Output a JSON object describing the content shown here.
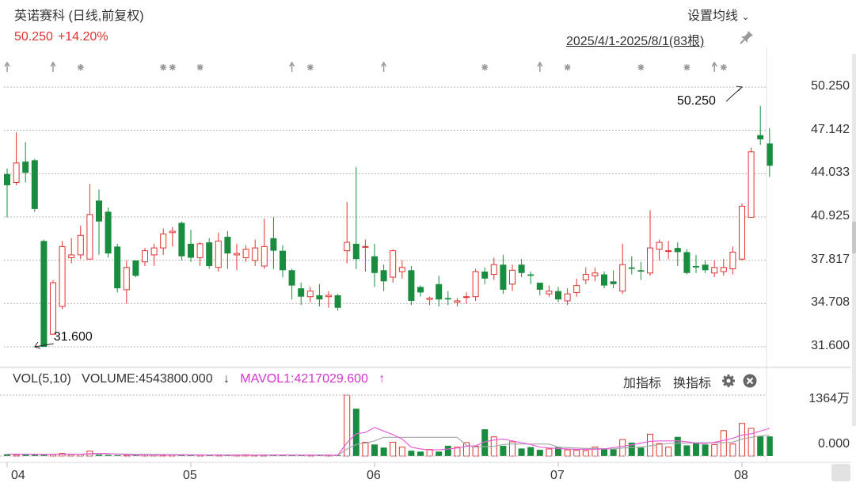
{
  "header": {
    "title": "英诺赛科 (日线,前复权)",
    "price": "50.250",
    "change_pct": "+14.20%",
    "ma_setting_label": "设置均线",
    "date_range": "2025/4/1-2025/8/1(83根)"
  },
  "volume_legend": {
    "vol_label": "VOL(5,10)",
    "volume_label": "VOLUME:4543800.000",
    "volume_arrow": "↓",
    "mavol_label": "MAVOL1:4217029.600",
    "mavol_arrow": "↑"
  },
  "toolbar": {
    "add_indicator": "加指标",
    "change_indicator": "换指标"
  },
  "colors": {
    "up": "#e0332f",
    "down": "#1a8c3f",
    "mavol1": "#e85fd8",
    "mavol2": "#a8a8a8",
    "grid": "#b5b5b5"
  },
  "chart_data": {
    "type": "candlestick",
    "y_axis_ticks": [
      "50.250",
      "47.142",
      "44.033",
      "40.925",
      "37.817",
      "34.708",
      "31.600"
    ],
    "ylim": [
      31.6,
      50.25
    ],
    "volume_axis_ticks": [
      "1364万",
      "0.000"
    ],
    "x_tick_labels": [
      "04",
      "05",
      "06",
      "07",
      "08"
    ],
    "x_tick_index": [
      0,
      20,
      40,
      60,
      80
    ],
    "annotations": [
      {
        "label": "50.250",
        "index": 80,
        "value": 50.25
      },
      {
        "label": "31.600",
        "index": 3,
        "value": 31.6
      }
    ],
    "ohlc": [
      [
        44.0,
        43.2,
        44.4,
        40.9
      ],
      [
        43.4,
        44.8,
        47.0,
        43.2
      ],
      [
        44.9,
        44.1,
        46.3,
        43.4
      ],
      [
        45.0,
        41.5,
        45.1,
        41.3
      ],
      [
        39.2,
        31.6,
        39.3,
        31.6
      ],
      [
        32.5,
        36.2,
        36.4,
        32.5
      ],
      [
        34.5,
        38.8,
        39.2,
        34.3
      ],
      [
        38.0,
        38.2,
        39.4,
        37.6
      ],
      [
        38.2,
        39.6,
        40.3,
        37.9
      ],
      [
        37.9,
        41.1,
        43.3,
        37.9
      ],
      [
        42.1,
        40.6,
        42.9,
        38.2
      ],
      [
        41.3,
        38.3,
        41.6,
        38.0
      ],
      [
        38.8,
        35.8,
        39.0,
        35.5
      ],
      [
        35.7,
        37.3,
        37.8,
        34.7
      ],
      [
        37.8,
        36.7,
        37.8,
        36.6
      ],
      [
        37.7,
        38.5,
        38.7,
        37.4
      ],
      [
        38.2,
        38.7,
        39.0,
        37.4
      ],
      [
        38.7,
        39.7,
        40.1,
        38.2
      ],
      [
        39.8,
        39.9,
        40.2,
        38.8
      ],
      [
        40.5,
        38.1,
        40.6,
        37.8
      ],
      [
        39.0,
        38.0,
        40.0,
        37.7
      ],
      [
        38.0,
        39.0,
        39.1,
        37.4
      ],
      [
        39.1,
        37.4,
        39.4,
        37.2
      ],
      [
        37.3,
        39.2,
        39.8,
        37.0
      ],
      [
        39.5,
        38.3,
        39.9,
        37.2
      ],
      [
        38.2,
        38.3,
        39.0,
        37.1
      ],
      [
        38.0,
        38.6,
        38.9,
        37.7
      ],
      [
        37.8,
        38.7,
        39.3,
        37.4
      ],
      [
        37.4,
        38.8,
        40.8,
        37.2
      ],
      [
        39.4,
        38.5,
        40.9,
        37.2
      ],
      [
        38.5,
        37.1,
        38.9,
        36.6
      ],
      [
        37.1,
        36.0,
        37.2,
        35.0
      ],
      [
        35.8,
        35.2,
        36.2,
        34.6
      ],
      [
        35.2,
        35.6,
        35.9,
        34.8
      ],
      [
        35.3,
        35.0,
        36.1,
        34.5
      ],
      [
        35.2,
        35.3,
        35.6,
        34.4
      ],
      [
        35.3,
        34.4,
        35.4,
        34.2
      ],
      [
        38.5,
        39.1,
        42.0,
        37.6
      ],
      [
        39.0,
        37.9,
        44.5,
        37.2
      ],
      [
        38.8,
        38.8,
        39.3,
        37.0
      ],
      [
        38.1,
        36.9,
        39.0,
        35.9
      ],
      [
        37.1,
        36.3,
        37.5,
        35.6
      ],
      [
        36.6,
        38.5,
        38.6,
        36.2
      ],
      [
        37.0,
        37.3,
        37.8,
        36.5
      ],
      [
        37.1,
        34.9,
        37.4,
        34.6
      ],
      [
        35.9,
        35.5,
        36.0,
        35.2
      ],
      [
        35.0,
        35.1,
        35.2,
        34.6
      ],
      [
        36.1,
        35.0,
        36.7,
        34.5
      ],
      [
        35.1,
        35.0,
        35.6,
        34.6
      ],
      [
        34.8,
        34.9,
        35.1,
        34.5
      ],
      [
        35.2,
        35.2,
        35.5,
        34.7
      ],
      [
        35.2,
        37.0,
        37.2,
        34.9
      ],
      [
        37.0,
        36.5,
        37.3,
        36.1
      ],
      [
        36.8,
        37.5,
        38.0,
        36.4
      ],
      [
        37.5,
        35.7,
        38.2,
        35.4
      ],
      [
        36.1,
        37.1,
        37.5,
        35.6
      ],
      [
        37.5,
        36.9,
        37.9,
        36.6
      ],
      [
        36.8,
        36.7,
        37.0,
        36.1
      ],
      [
        36.2,
        35.7,
        36.2,
        35.3
      ],
      [
        35.4,
        35.6,
        36.0,
        35.2
      ],
      [
        35.6,
        35.0,
        35.9,
        34.8
      ],
      [
        34.9,
        35.4,
        35.8,
        34.6
      ],
      [
        35.5,
        36.0,
        36.5,
        35.2
      ],
      [
        36.4,
        36.8,
        37.3,
        36.1
      ],
      [
        36.7,
        36.9,
        37.3,
        36.3
      ],
      [
        36.8,
        36.0,
        37.0,
        35.8
      ],
      [
        36.3,
        36.1,
        37.1,
        35.8
      ],
      [
        35.6,
        37.5,
        39.0,
        35.4
      ],
      [
        37.3,
        37.2,
        38.1,
        36.8
      ],
      [
        37.1,
        37.0,
        37.7,
        36.4
      ],
      [
        36.9,
        38.7,
        41.4,
        36.7
      ],
      [
        38.6,
        39.1,
        39.3,
        37.8
      ],
      [
        38.5,
        38.5,
        39.2,
        37.9
      ],
      [
        38.7,
        38.4,
        39.1,
        37.4
      ],
      [
        38.4,
        36.9,
        38.6,
        36.8
      ],
      [
        37.4,
        37.3,
        38.2,
        36.9
      ],
      [
        37.5,
        37.1,
        37.8,
        36.9
      ],
      [
        36.9,
        37.3,
        37.8,
        36.6
      ],
      [
        37.0,
        37.3,
        37.9,
        36.7
      ],
      [
        37.2,
        38.4,
        38.8,
        36.8
      ],
      [
        37.9,
        41.7,
        41.9,
        37.8
      ],
      [
        40.9,
        45.6,
        45.9,
        40.9
      ],
      [
        46.8,
        46.5,
        48.9,
        46.1
      ],
      [
        46.2,
        44.6,
        47.3,
        43.8
      ]
    ],
    "volume_wan": [
      40,
      25,
      35,
      38,
      42,
      30,
      60,
      30,
      35,
      110,
      30,
      25,
      20,
      20,
      25,
      30,
      25,
      20,
      30,
      25,
      35,
      25,
      30,
      20,
      20,
      25,
      30,
      20,
      25,
      25,
      30,
      25,
      20,
      20,
      25,
      20,
      20,
      1364,
      1060,
      310,
      260,
      190,
      310,
      200,
      120,
      100,
      150,
      100,
      230,
      200,
      300,
      220,
      600,
      430,
      230,
      320,
      170,
      200,
      140,
      160,
      200,
      140,
      130,
      120,
      200,
      160,
      150,
      370,
      300,
      190,
      490,
      280,
      200,
      430,
      240,
      300,
      260,
      260,
      570,
      270,
      730,
      620,
      440,
      440
    ],
    "mavol1_wan": [
      40,
      40,
      40,
      38,
      35,
      35,
      40,
      40,
      43,
      55,
      60,
      55,
      40,
      30,
      25,
      25,
      25,
      25,
      25,
      25,
      25,
      25,
      25,
      25,
      25,
      22,
      22,
      22,
      22,
      25,
      25,
      25,
      22,
      22,
      22,
      22,
      20,
      300,
      500,
      530,
      640,
      560,
      480,
      380,
      200,
      160,
      140,
      140,
      160,
      180,
      220,
      230,
      320,
      360,
      380,
      340,
      300,
      260,
      200,
      180,
      170,
      160,
      150,
      150,
      150,
      160,
      190,
      220,
      250,
      290,
      330,
      340,
      340,
      340,
      320,
      290,
      280,
      310,
      350,
      400,
      470,
      500,
      560,
      620
    ],
    "mavol2_wan": [
      40,
      40,
      40,
      40,
      38,
      37,
      37,
      38,
      40,
      45,
      48,
      47,
      47,
      45,
      40,
      38,
      36,
      35,
      34,
      33,
      28,
      26,
      25,
      25,
      25,
      24,
      23,
      23,
      23,
      23,
      23,
      23,
      23,
      23,
      23,
      23,
      22,
      160,
      260,
      290,
      340,
      420,
      420,
      420,
      420,
      420,
      420,
      420,
      420,
      420,
      240,
      200,
      210,
      220,
      260,
      270,
      270,
      270,
      270,
      270,
      200,
      190,
      180,
      170,
      170,
      165,
      160,
      180,
      190,
      200,
      230,
      260,
      280,
      290,
      290,
      300,
      300,
      300,
      300,
      310,
      380,
      420,
      450,
      470
    ]
  }
}
